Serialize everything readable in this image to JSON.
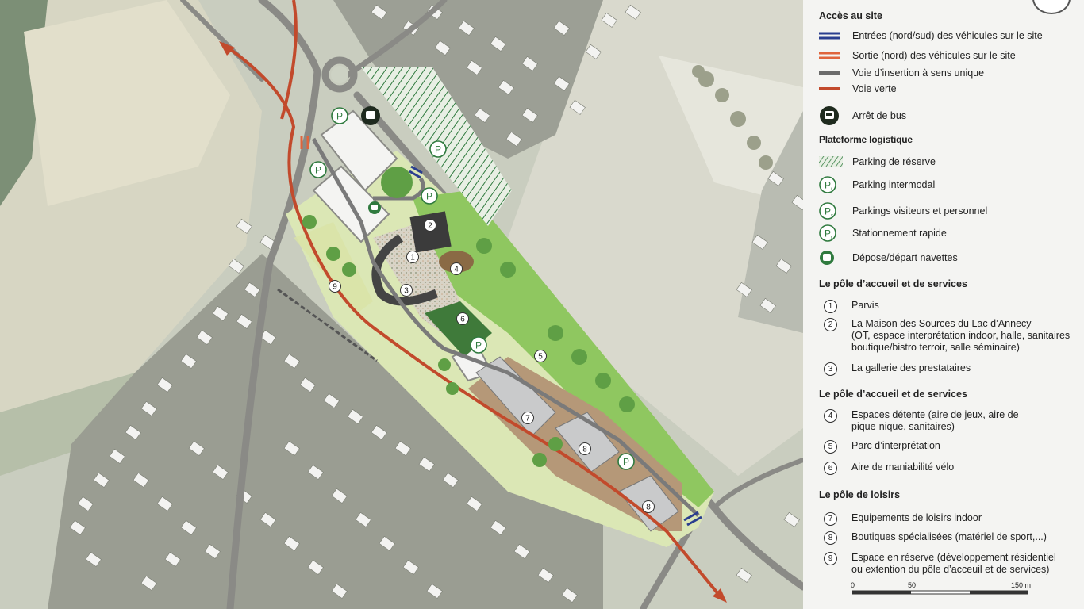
{
  "legend": {
    "access": {
      "title": "Accès au site",
      "items": [
        {
          "label": "Entrées (nord/sud)  des véhicules sur le site",
          "color": "#2a3e8f",
          "icon": "double-line-blue"
        },
        {
          "label": "Sortie (nord) des véhicules sur le site",
          "color": "#e0643c",
          "icon": "double-line-orange"
        },
        {
          "label": "Voie d’insertion à sens unique",
          "color": "#6b6b6b",
          "icon": "grey-line"
        },
        {
          "label": "Voie verte",
          "color": "#c24a2c",
          "icon": "red-line"
        },
        {
          "label": "Arrêt de bus",
          "color": "#1e2a1e",
          "icon": "bus-stop-icon"
        }
      ]
    },
    "platform": {
      "title": "Plateforme logistique",
      "items": [
        {
          "label": "Parking de réserve",
          "color": "#2f7a3e",
          "icon": "hatched-parking",
          "glyph": ""
        },
        {
          "label": "Parking intermodal",
          "color": "#2f7a3e",
          "icon": "parking-icon",
          "glyph": "P",
          "sub": "i"
        },
        {
          "label": "Parkings visiteurs et personnel",
          "color": "#2f7a3e",
          "icon": "parking-icon",
          "glyph": "P",
          "sub": "v"
        },
        {
          "label": "Stationnement rapide",
          "color": "#2f7a3e",
          "icon": "parking-icon",
          "glyph": "P",
          "sub": "r"
        },
        {
          "label": "Dépose/départ navettes",
          "color": "#2f7a3e",
          "icon": "shuttle-icon",
          "glyph": ""
        }
      ]
    },
    "poles": [
      {
        "title": "Le pôle d’accueil et de services",
        "items": [
          {
            "n": "1",
            "lines": [
              "Parvis"
            ]
          },
          {
            "n": "2",
            "lines": [
              "La Maison des Sources du Lac d’Annecy",
              "(OT, espace interprétation indoor, halle, sanitaires",
              "boutique/bistro terroir, salle séminaire)"
            ]
          },
          {
            "n": "3",
            "lines": [
              "La gallerie des prestataires"
            ]
          }
        ]
      },
      {
        "title": "Le pôle d’accueil et de services",
        "items": [
          {
            "n": "4",
            "lines": [
              "Espaces détente (aire de jeux, aire de",
              "pique-nique, sanitaires)"
            ]
          },
          {
            "n": "5",
            "lines": [
              "Parc d’interprétation"
            ]
          },
          {
            "n": "6",
            "lines": [
              "Aire de maniabilité vélo"
            ]
          }
        ]
      },
      {
        "title": "Le pôle de loisirs",
        "items": [
          {
            "n": "7",
            "lines": [
              "Equipements de loisirs indoor"
            ]
          },
          {
            "n": "8",
            "lines": [
              "Boutiques spécialisées (matériel de sport,...)"
            ]
          },
          {
            "n": "9",
            "lines": [
              "Espace en réserve (développement résidentiel",
              "ou extention du pôle d’acceuil et de services)"
            ]
          }
        ]
      }
    ],
    "scale": {
      "labels": [
        "0",
        "50",
        "150 m"
      ]
    }
  },
  "map": {
    "markers": [
      "1",
      "2",
      "3",
      "4",
      "5",
      "6",
      "7",
      "8",
      "8",
      "9"
    ],
    "parking_glyph": "P"
  },
  "colors": {
    "park_green": "#8fc760",
    "gravel": "#b59878",
    "road": "#7a7a7a",
    "greenway": "#c24a2c",
    "entry_blue": "#2a3e8f",
    "exit_orange": "#e0643c"
  }
}
